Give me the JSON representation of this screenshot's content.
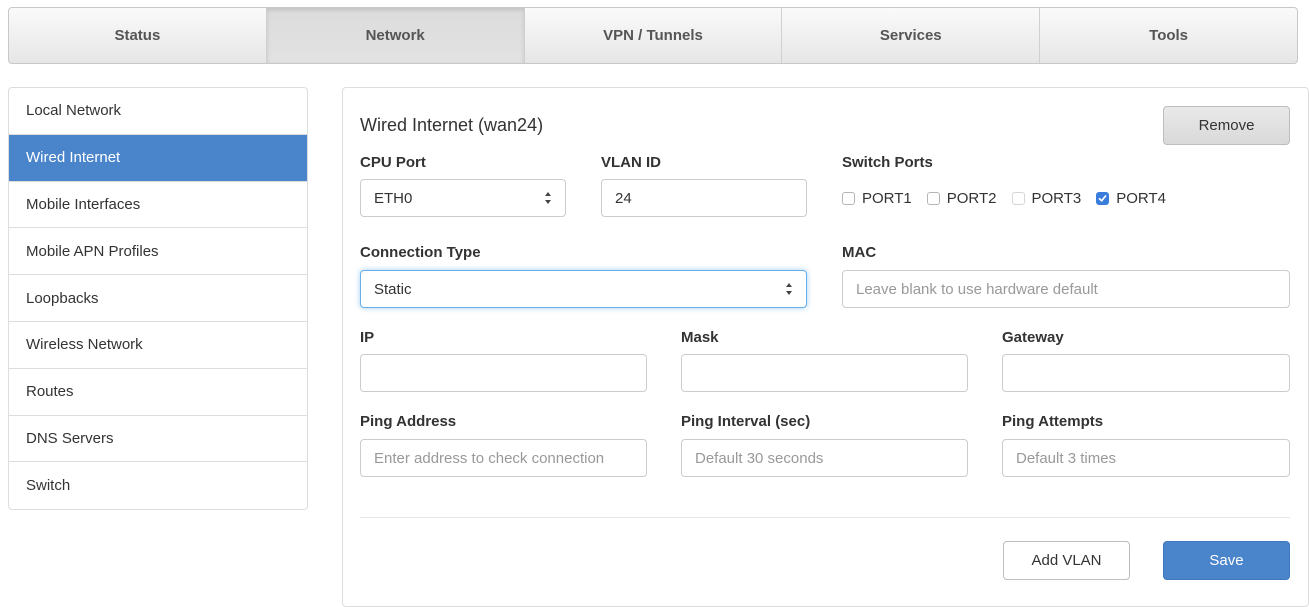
{
  "topnav": {
    "tabs": [
      {
        "label": "Status",
        "active": false
      },
      {
        "label": "Network",
        "active": true
      },
      {
        "label": "VPN / Tunnels",
        "active": false
      },
      {
        "label": "Services",
        "active": false
      },
      {
        "label": "Tools",
        "active": false
      }
    ]
  },
  "sidebar": {
    "items": [
      {
        "label": "Local Network"
      },
      {
        "label": "Wired Internet",
        "active": true
      },
      {
        "label": "Mobile Interfaces"
      },
      {
        "label": "Mobile APN Profiles"
      },
      {
        "label": "Loopbacks"
      },
      {
        "label": "Wireless Network"
      },
      {
        "label": "Routes"
      },
      {
        "label": "DNS Servers"
      },
      {
        "label": "Switch"
      }
    ]
  },
  "panel": {
    "title": "Wired Internet (wan24)",
    "remove_label": "Remove",
    "cpu_port": {
      "label": "CPU Port",
      "value": "ETH0"
    },
    "vlan_id": {
      "label": "VLAN ID",
      "value": "24"
    },
    "switch_ports": {
      "label": "Switch Ports",
      "ports": [
        {
          "label": "PORT1",
          "checked": false
        },
        {
          "label": "PORT2",
          "checked": false
        },
        {
          "label": "PORT3",
          "checked": false
        },
        {
          "label": "PORT4",
          "checked": true
        }
      ]
    },
    "connection_type": {
      "label": "Connection Type",
      "value": "Static"
    },
    "mac": {
      "label": "MAC",
      "placeholder": "Leave blank to use hardware default"
    },
    "ip": {
      "label": "IP",
      "value": ""
    },
    "mask": {
      "label": "Mask",
      "value": ""
    },
    "gateway": {
      "label": "Gateway",
      "value": ""
    },
    "ping_address": {
      "label": "Ping Address",
      "placeholder": "Enter address to check connection"
    },
    "ping_interval": {
      "label": "Ping Interval (sec)",
      "placeholder": "Default 30 seconds"
    },
    "ping_attempts": {
      "label": "Ping Attempts",
      "placeholder": "Default 3 times"
    },
    "add_vlan_label": "Add VLAN",
    "save_label": "Save"
  },
  "colors": {
    "accent": "#4a84cb",
    "checkbox_checked": "#3b7ddd",
    "focus_ring": "#66afe9"
  }
}
